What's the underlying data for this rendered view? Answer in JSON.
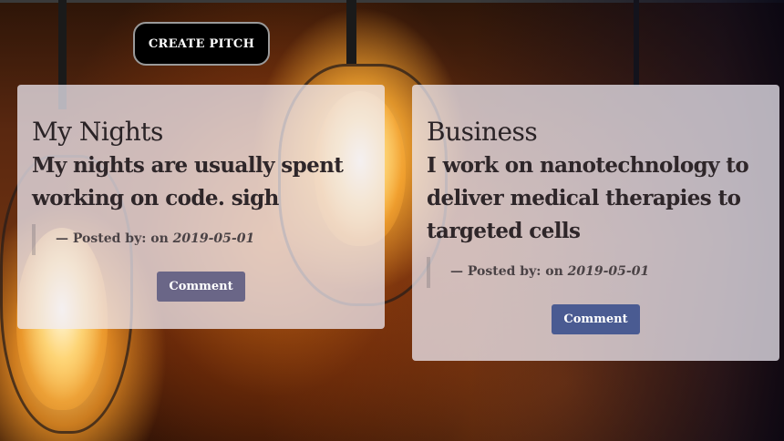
{
  "header": {
    "create_button_label": "CREATE PITCH"
  },
  "colors": {
    "comment_button_1": "#6a6687",
    "comment_button_2": "#4a5b92",
    "create_button_bg": "#000000"
  },
  "pitches": [
    {
      "category": "My Nights",
      "title": "My nights are usually spent working on code. sigh",
      "posted_by_label": "— Posted by: on",
      "date": "2019-05-01",
      "comment_label": "Comment"
    },
    {
      "category": "Business",
      "title": "I work on nanotechnology to deliver medical therapies to targeted cells",
      "posted_by_label": "— Posted by: on",
      "date": "2019-05-01",
      "comment_label": "Comment"
    }
  ]
}
